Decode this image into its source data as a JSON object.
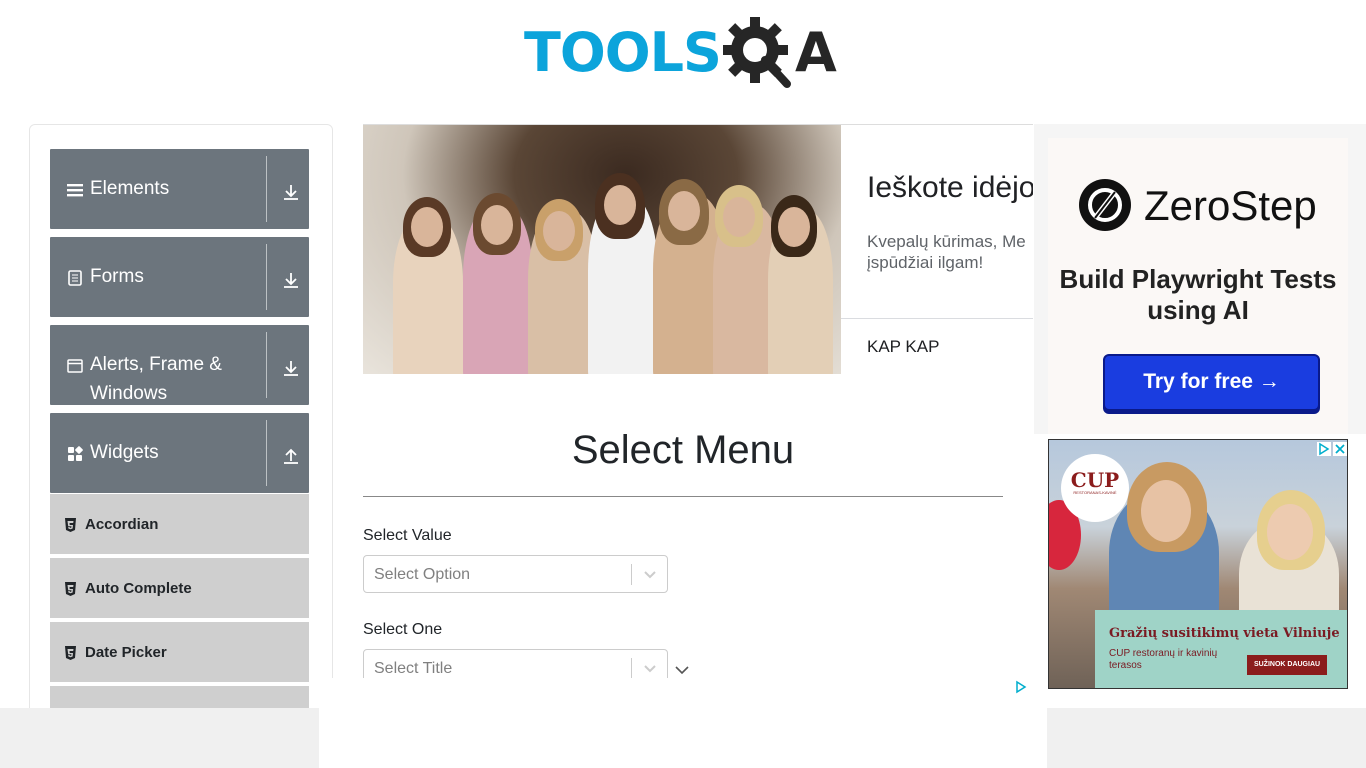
{
  "header": {
    "logo_part1": "TOOLS",
    "logo_part2": "QA"
  },
  "sidebar": {
    "groups": [
      {
        "label": "Elements",
        "icon": "hamburger-icon",
        "state": "collapsed"
      },
      {
        "label": "Forms",
        "icon": "document-icon",
        "state": "collapsed"
      },
      {
        "label": "Alerts, Frame & Windows",
        "icon": "window-icon",
        "state": "collapsed"
      },
      {
        "label": "Widgets",
        "icon": "widgets-icon",
        "state": "expanded"
      }
    ],
    "items": [
      {
        "label": "Accordian",
        "icon": "html5-icon"
      },
      {
        "label": "Auto Complete",
        "icon": "html5-icon"
      },
      {
        "label": "Date Picker",
        "icon": "html5-icon"
      }
    ]
  },
  "top_ad": {
    "headline": "Ieškote idėjo",
    "body": "Kvepalų kūrimas, Me įspūdžiai ilgam!",
    "advertiser": "KAP KAP"
  },
  "main": {
    "title": "Select Menu",
    "fields": [
      {
        "label": "Select Value",
        "placeholder": "Select Option"
      },
      {
        "label": "Select One",
        "placeholder": "Select Title"
      }
    ]
  },
  "right_ad_1": {
    "brand": "ZeroStep",
    "tagline": "Build Playwright Tests using AI",
    "cta": "Try for free →"
  },
  "right_ad_2": {
    "badge": "CUP",
    "badge_sub": "RESTORANAS-KAVINĖ",
    "headline": "Gražių susitikimų vieta Vilniuje",
    "sub": "CUP restoranų ir kavinių terasos",
    "cta": "SUŽINOK DAUGIAU"
  },
  "colors": {
    "brand_blue": "#0ca4db",
    "sidebar_group": "#6c757d",
    "sidebar_item": "#cfcfcf",
    "cta_blue": "#1a3de0",
    "cup_red": "#8b1c1c"
  }
}
